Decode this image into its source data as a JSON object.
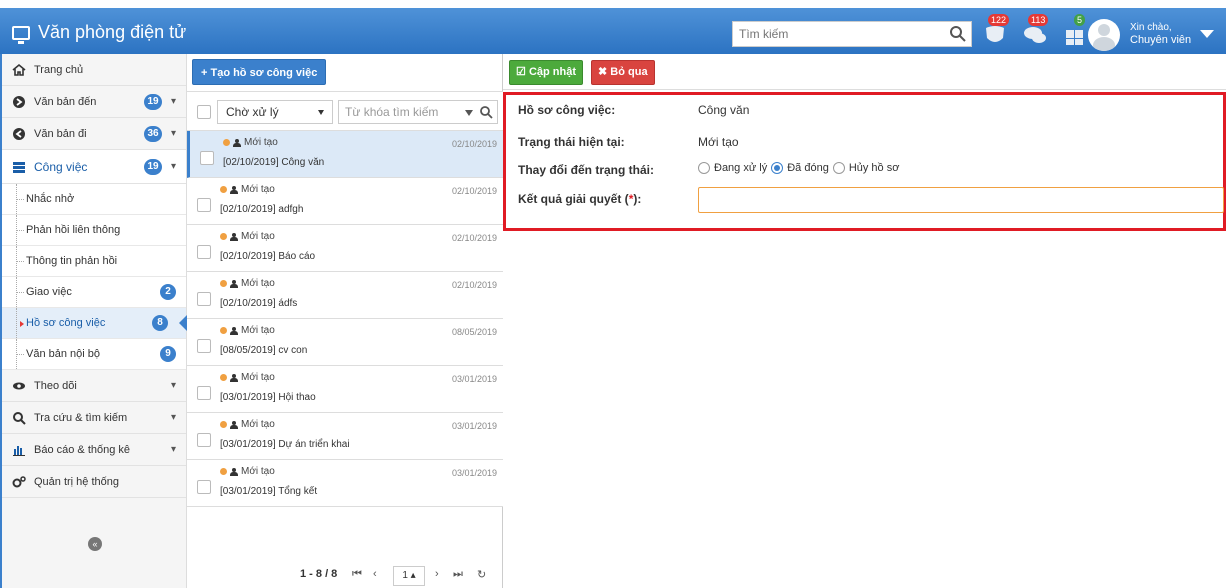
{
  "header": {
    "title": "Văn phòng điện tử",
    "search_placeholder": "Tìm kiếm",
    "badges": {
      "notifications": "122",
      "messages": "113",
      "tasks": "5"
    },
    "greeting": "Xin chào,",
    "role": "Chuyên viên"
  },
  "sidebar": {
    "items": [
      {
        "label": "Trang chủ",
        "icon": "home-icon"
      },
      {
        "label": "Văn bản đến",
        "count": "19",
        "icon": "arrow-right-circle-icon"
      },
      {
        "label": "Văn bản đi",
        "count": "36",
        "icon": "arrow-left-circle-icon"
      },
      {
        "label": "Công việc",
        "count": "19",
        "icon": "tasks-icon"
      }
    ],
    "sub_items": [
      {
        "label": "Nhắc nhở"
      },
      {
        "label": "Phản hồi liên thông"
      },
      {
        "label": "Thông tin phản hồi"
      },
      {
        "label": "Giao việc",
        "count": "2"
      },
      {
        "label": "Hồ sơ công việc",
        "count": "8"
      },
      {
        "label": "Văn bản nội bộ",
        "count": "9"
      }
    ],
    "bottom_items": [
      {
        "label": "Theo dõi",
        "icon": "eye-icon"
      },
      {
        "label": "Tra cứu & tìm kiếm",
        "icon": "search-icon"
      },
      {
        "label": "Báo cáo & thống kê",
        "icon": "bar-chart-icon"
      },
      {
        "label": "Quản trị hệ thống",
        "icon": "gears-icon"
      }
    ]
  },
  "list": {
    "create_button": "+ Tạo hồ sơ công việc",
    "status_filter": "Chờ xử lý",
    "keyword_placeholder": "Từ khóa tìm kiếm",
    "rows": [
      {
        "status": "Mới tạo",
        "date": "02/10/2019",
        "title": "[02/10/2019] Công văn"
      },
      {
        "status": "Mới tạo",
        "date": "02/10/2019",
        "title": "[02/10/2019] adfgh"
      },
      {
        "status": "Mới tạo",
        "date": "02/10/2019",
        "title": "[02/10/2019] Báo cáo"
      },
      {
        "status": "Mới tạo",
        "date": "02/10/2019",
        "title": "[02/10/2019] ádfs"
      },
      {
        "status": "Mới tạo",
        "date": "08/05/2019",
        "title": "[08/05/2019] cv con"
      },
      {
        "status": "Mới tạo",
        "date": "03/01/2019",
        "title": "[03/01/2019] Hội thao"
      },
      {
        "status": "Mới tạo",
        "date": "03/01/2019",
        "title": "[03/01/2019] Dự án triển khai"
      },
      {
        "status": "Mới tạo",
        "date": "03/01/2019",
        "title": "[03/01/2019] Tổng kết"
      }
    ],
    "pager": {
      "info": "1 - 8 / 8",
      "page": "1"
    }
  },
  "detail": {
    "update_button": "Cập nhật",
    "cancel_button": "Bỏ qua",
    "fields": {
      "profile_label": "Hồ sơ công việc:",
      "profile_value": "Công văn",
      "current_status_label": "Trạng thái hiện tại:",
      "current_status_value": "Mới tạo",
      "change_status_label": "Thay đổi đến trạng thái:",
      "result_label": "Kết quả giải quyết (",
      "result_req": "*",
      "result_label_end": "):",
      "result_value": ""
    },
    "status_options": [
      "Đang xử lý",
      "Đã đóng",
      "Hủy hồ sơ"
    ],
    "selected_status": "Đã đóng"
  },
  "colors": {
    "header_blue": "#3b80cc",
    "update_green": "#4caa3c",
    "cancel_red": "#d9443f",
    "form_border_red": "#e01b24",
    "status_dot_orange": "#f0a041"
  }
}
